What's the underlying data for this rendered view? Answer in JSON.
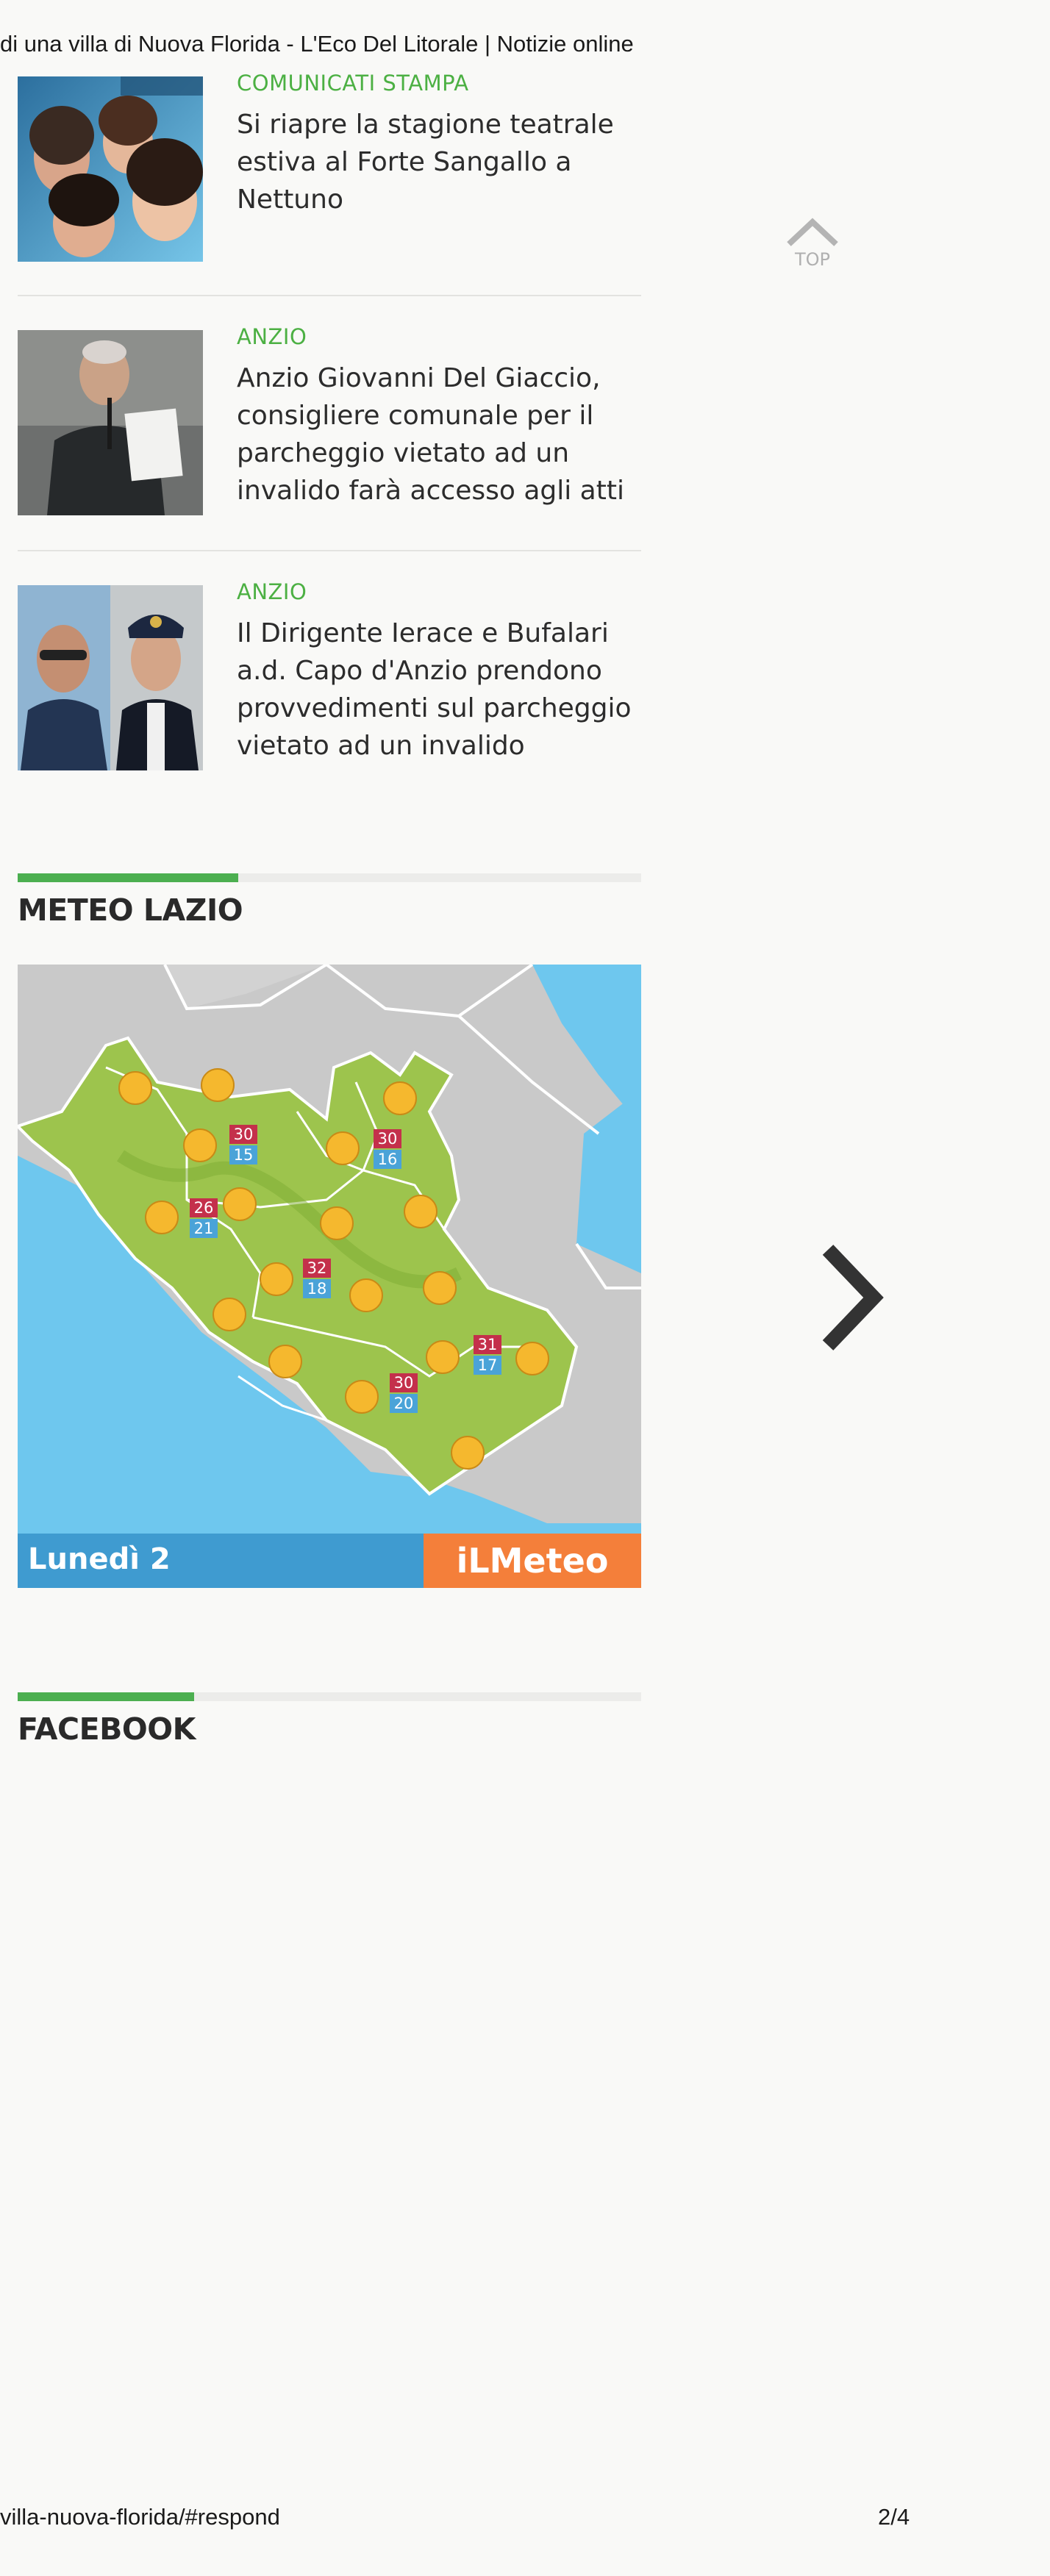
{
  "print": {
    "header_title": "di una villa di Nuova Florida - L'Eco Del Litorale | Notizie online",
    "footer_url": "villa-nuova-florida/#respond",
    "page_number": "2/4"
  },
  "news": [
    {
      "category": "COMUNICATI STAMPA",
      "title": "Si riapre la stagione teatrale estiva al Forte Sangallo a Nettuno"
    },
    {
      "category": "ANZIO",
      "title": "Anzio Giovanni Del Giaccio, consigliere comunale per il parcheggio vietato ad un invalido farà accesso agli atti"
    },
    {
      "category": "ANZIO",
      "title": "Il Dirigente Ierace e Bufalari a.d. Capo d'Anzio prendono provvedimenti sul parcheggio vietato ad un invalido"
    }
  ],
  "sections": {
    "meteo_title": "METEO LAZIO",
    "facebook_title": "FACEBOOK"
  },
  "weather": {
    "day_label": "Lunedì 2",
    "brand_prefix": "iL",
    "brand_name": "Meteo",
    "temps": [
      {
        "max": "30",
        "min": "15"
      },
      {
        "max": "30",
        "min": "16"
      },
      {
        "max": "26",
        "min": "21"
      },
      {
        "max": "32",
        "min": "18"
      },
      {
        "max": "31",
        "min": "17"
      },
      {
        "max": "30",
        "min": "20"
      }
    ],
    "colors": {
      "sea": "#6ec7ee",
      "land_outside": "#c9c9c9",
      "region": "#9dc44d",
      "day_bar": "#3f9bd0",
      "brand_bar": "#f47f3a",
      "max_badge": "#c4304b",
      "min_badge": "#4aa3d8"
    }
  },
  "ui": {
    "top_label": "TOP",
    "accent": "#4cb043"
  }
}
